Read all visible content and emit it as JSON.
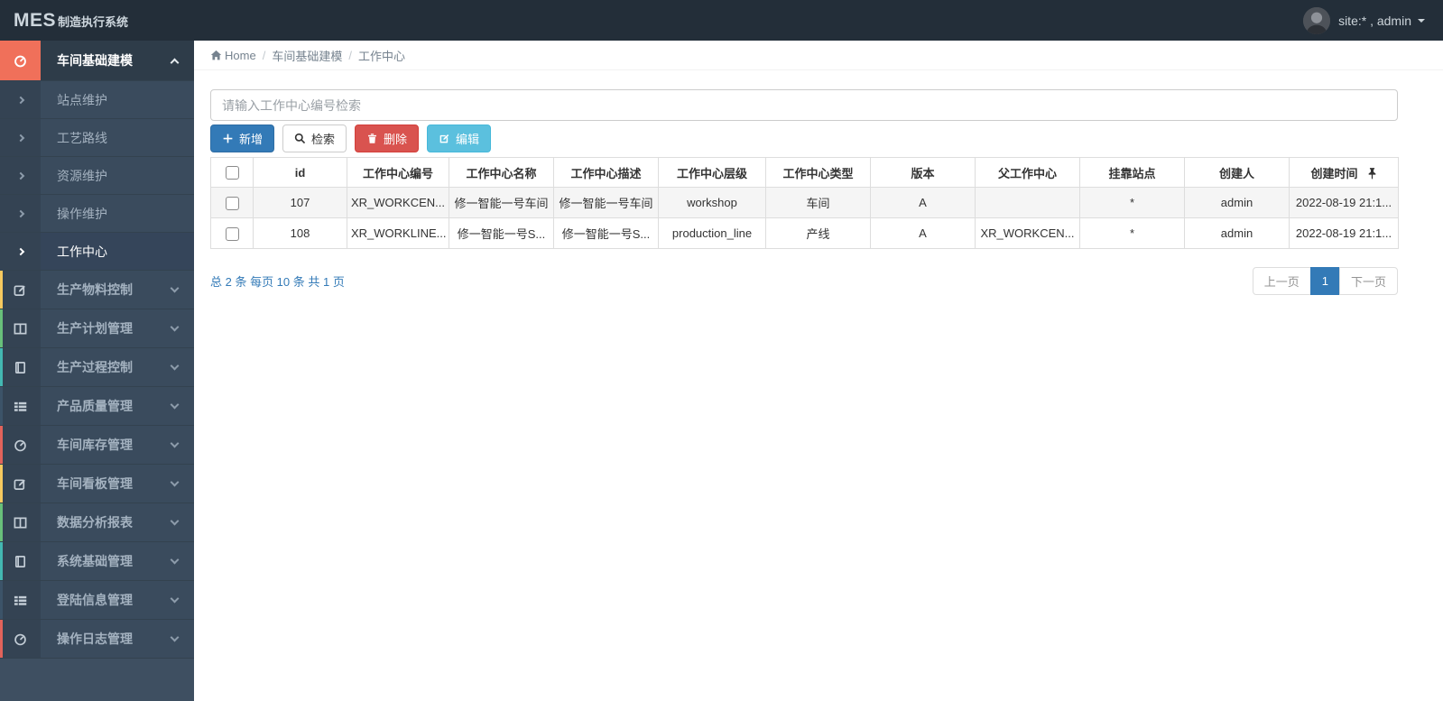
{
  "theme": {
    "topbar_bg": "#232e39",
    "sidebar_bg": "#3e4f61",
    "accent_salmon": "#f0705a",
    "primary_blue": "#337ab7",
    "danger_red": "#d9534f",
    "info_cyan": "#5bc0de",
    "stripe_yellow": "#f6c95f",
    "stripe_green": "#68c07a",
    "stripe_teal": "#43b8b2",
    "stripe_navy": "#3c5368",
    "stripe_red": "#e2635b"
  },
  "topbar": {
    "logo_primary": "MES",
    "logo_secondary": "制造执行系统",
    "user_label": "site:* , admin"
  },
  "breadcrumb": {
    "home": "Home",
    "section": "车间基础建模",
    "current": "工作中心"
  },
  "sidebar": {
    "active_parent": {
      "label": "车间基础建模",
      "icon": "gauge-icon"
    },
    "submenu": [
      {
        "label": "站点维护"
      },
      {
        "label": "工艺路线"
      },
      {
        "label": "资源维护"
      },
      {
        "label": "操作维护"
      },
      {
        "label": "工作中心"
      }
    ],
    "parents": [
      {
        "label": "生产物料控制",
        "icon": "edit-icon",
        "stripe": "#f6c95f"
      },
      {
        "label": "生产计划管理",
        "icon": "columns-icon",
        "stripe": "#68c07a"
      },
      {
        "label": "生产过程控制",
        "icon": "book-icon",
        "stripe": "#43b8b2"
      },
      {
        "label": "产品质量管理",
        "icon": "list-icon",
        "stripe": "#3c5368"
      },
      {
        "label": "车间库存管理",
        "icon": "gauge-icon",
        "stripe": "#e2635b"
      },
      {
        "label": "车间看板管理",
        "icon": "edit-icon",
        "stripe": "#f6c95f"
      },
      {
        "label": "数据分析报表",
        "icon": "columns-icon",
        "stripe": "#68c07a"
      },
      {
        "label": "系统基础管理",
        "icon": "book-icon",
        "stripe": "#43b8b2"
      },
      {
        "label": "登陆信息管理",
        "icon": "list-icon",
        "stripe": "#3c5368"
      },
      {
        "label": "操作日志管理",
        "icon": "gauge-icon",
        "stripe": "#e2635b"
      }
    ]
  },
  "toolbar": {
    "search_placeholder": "请输入工作中心编号检索",
    "add_label": "新增",
    "search_label": "检索",
    "delete_label": "删除",
    "edit_label": "编辑"
  },
  "table": {
    "headers": [
      "id",
      "工作中心编号",
      "工作中心名称",
      "工作中心描述",
      "工作中心层级",
      "工作中心类型",
      "版本",
      "父工作中心",
      "挂靠站点",
      "创建人",
      "创建时间"
    ],
    "rows": [
      {
        "cells": [
          "107",
          "XR_WORKCEN...",
          "修一智能一号车间",
          "修一智能一号车间",
          "workshop",
          "车间",
          "A",
          "",
          "*",
          "admin",
          "2022-08-19 21:1..."
        ]
      },
      {
        "cells": [
          "108",
          "XR_WORKLINE...",
          "修一智能一号S...",
          "修一智能一号S...",
          "production_line",
          "产线",
          "A",
          "XR_WORKCEN...",
          "*",
          "admin",
          "2022-08-19 21:1..."
        ]
      }
    ]
  },
  "pagination": {
    "summary": "总 2 条 每页 10 条 共 1 页",
    "prev_label": "上一页",
    "page_label": "1",
    "next_label": "下一页"
  }
}
